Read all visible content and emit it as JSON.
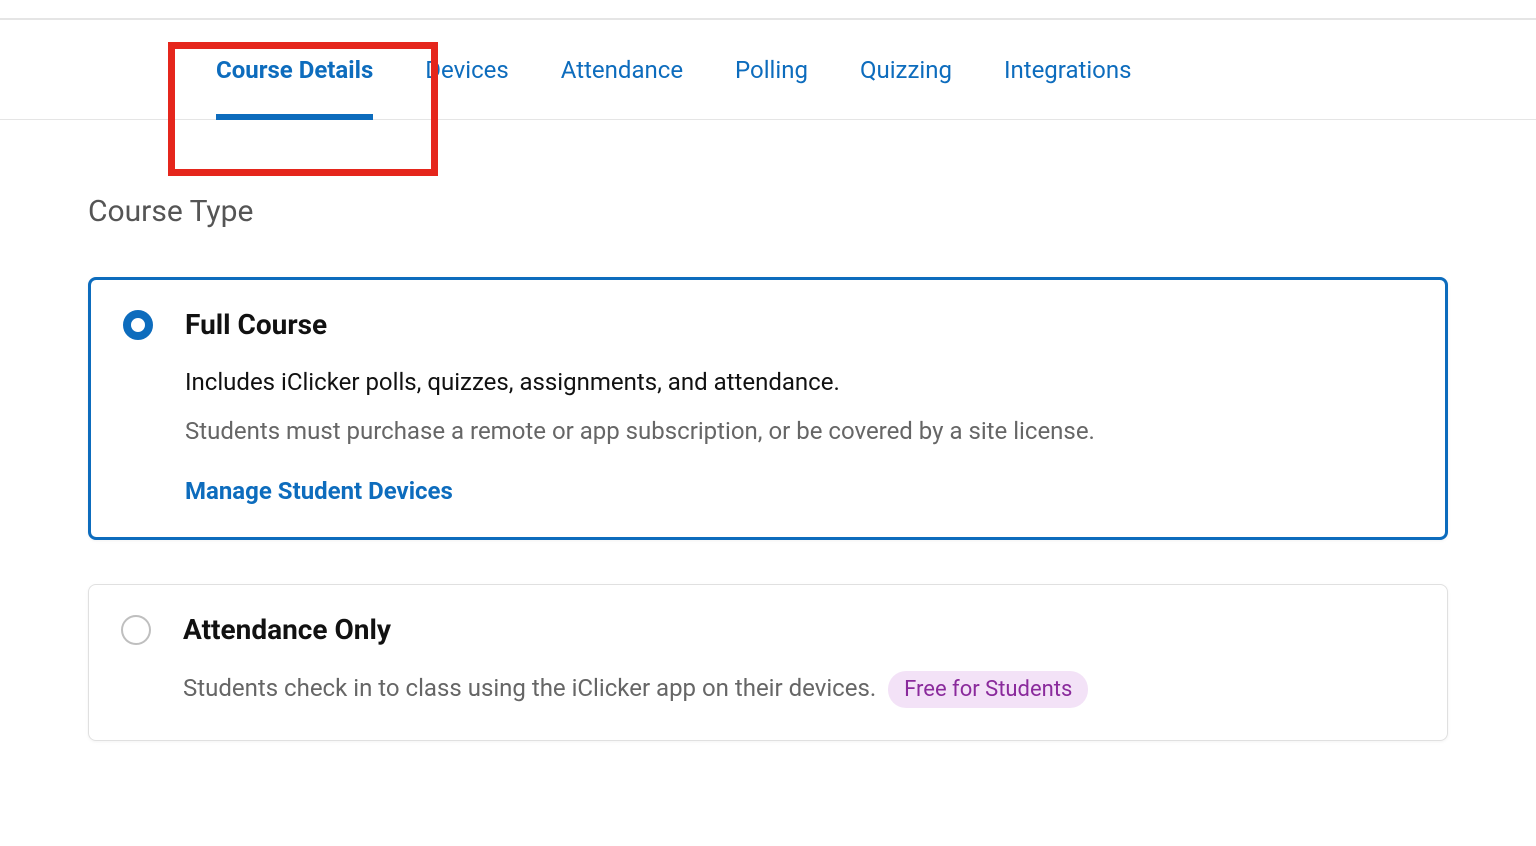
{
  "tabs": [
    {
      "label": "Course Details",
      "active": true
    },
    {
      "label": "Devices",
      "active": false
    },
    {
      "label": "Attendance",
      "active": false
    },
    {
      "label": "Polling",
      "active": false
    },
    {
      "label": "Quizzing",
      "active": false
    },
    {
      "label": "Integrations",
      "active": false
    }
  ],
  "section_heading": "Course Type",
  "options": {
    "full_course": {
      "title": "Full Course",
      "desc": "Includes iClicker polls, quizzes, assignments, and attendance.",
      "subdesc": "Students must purchase a remote or app subscription, or be covered by a site license.",
      "link": "Manage Student Devices"
    },
    "attendance_only": {
      "title": "Attendance Only",
      "desc": "Students check in to class using the iClicker app on their devices.",
      "badge": "Free for Students"
    }
  }
}
